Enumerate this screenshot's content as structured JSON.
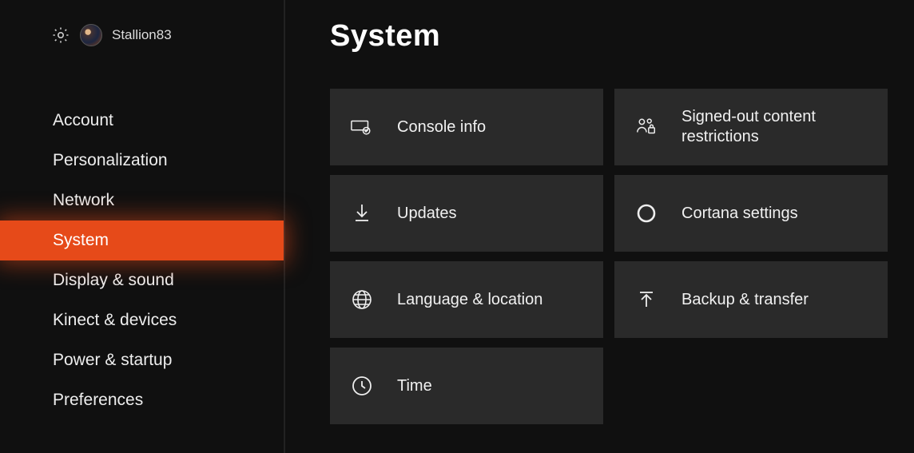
{
  "header": {
    "username": "Stallion83"
  },
  "sidebar": {
    "items": [
      {
        "label": "Account",
        "active": false
      },
      {
        "label": "Personalization",
        "active": false
      },
      {
        "label": "Network",
        "active": false
      },
      {
        "label": "System",
        "active": true
      },
      {
        "label": "Display & sound",
        "active": false
      },
      {
        "label": "Kinect & devices",
        "active": false
      },
      {
        "label": "Power & startup",
        "active": false
      },
      {
        "label": "Preferences",
        "active": false
      }
    ]
  },
  "page": {
    "title": "System"
  },
  "tiles": {
    "col1": [
      {
        "label": "Console info",
        "icon": "console-info-icon"
      },
      {
        "label": "Updates",
        "icon": "download-icon"
      },
      {
        "label": "Language & location",
        "icon": "globe-icon"
      },
      {
        "label": "Time",
        "icon": "clock-icon"
      }
    ],
    "col2": [
      {
        "label": "Signed-out content restrictions",
        "icon": "people-lock-icon"
      },
      {
        "label": "Cortana settings",
        "icon": "cortana-ring-icon"
      },
      {
        "label": "Backup & transfer",
        "icon": "upload-icon"
      }
    ]
  },
  "colors": {
    "accent": "#e64a19",
    "tile_bg": "#2a2a2a",
    "bg": "#101010"
  }
}
